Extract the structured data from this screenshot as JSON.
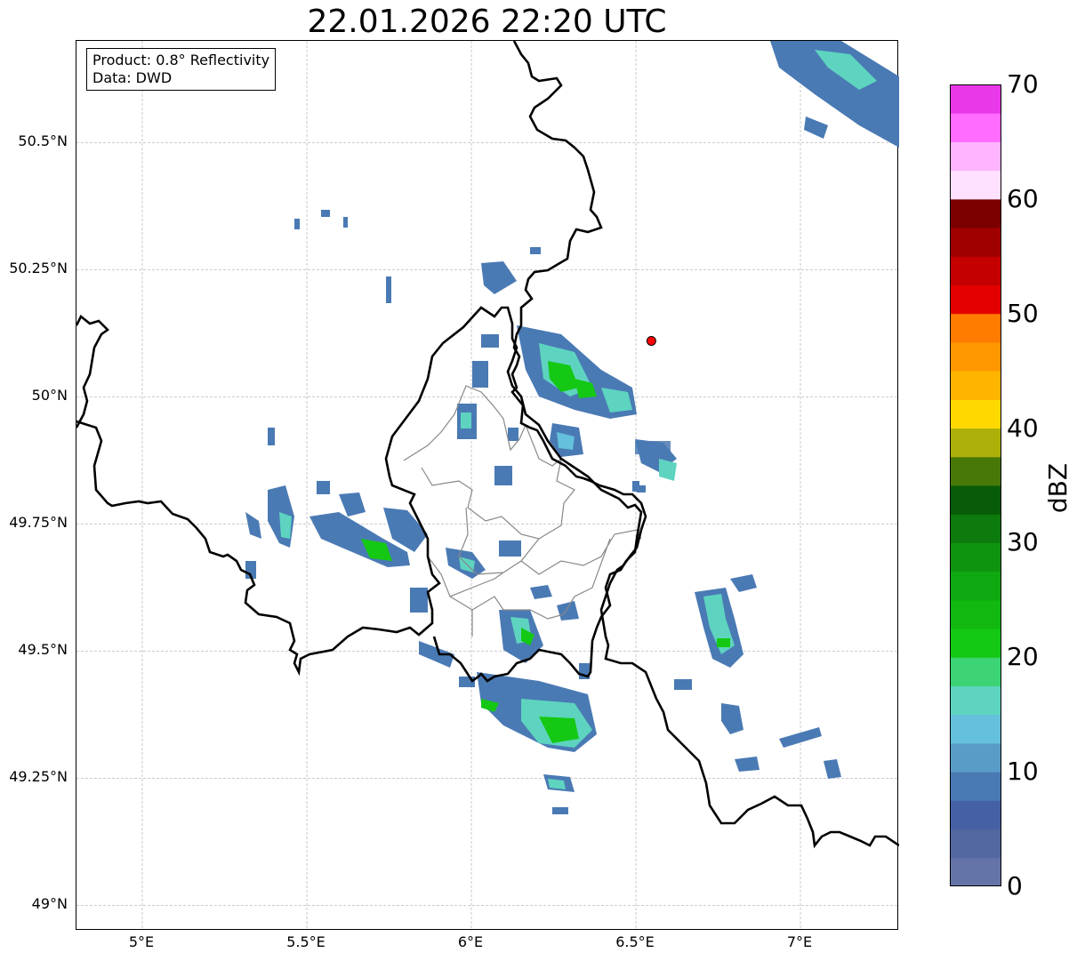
{
  "title": "22.01.2026 22:20 UTC",
  "info_box": {
    "product": "Product: 0.8° Reflectivity",
    "data_source": "Data: DWD"
  },
  "map": {
    "projection": "lat-lon",
    "lon_range": [
      4.8,
      7.3
    ],
    "lat_range": [
      48.95,
      50.7
    ],
    "grid": true,
    "lat_ticks": [
      {
        "value": 50.5,
        "label": "50.5°N"
      },
      {
        "value": 50.25,
        "label": "50.25°N"
      },
      {
        "value": 50.0,
        "label": "50°N"
      },
      {
        "value": 49.75,
        "label": "49.75°N"
      },
      {
        "value": 49.5,
        "label": "49.5°N"
      },
      {
        "value": 49.25,
        "label": "49.25°N"
      },
      {
        "value": 49.0,
        "label": "49°N"
      }
    ],
    "lon_ticks": [
      {
        "value": 5.0,
        "label": "5°E"
      },
      {
        "value": 5.5,
        "label": "5.5°E"
      },
      {
        "value": 6.0,
        "label": "6°E"
      },
      {
        "value": 6.5,
        "label": "6.5°E"
      },
      {
        "value": 7.0,
        "label": "7°E"
      }
    ],
    "radar_site": {
      "lon": 6.547,
      "lat": 50.11,
      "color": "#ff0000"
    },
    "border_color": "#000000",
    "admin_border_color": "#888888"
  },
  "colorbar": {
    "label": "dBZ",
    "min": 0,
    "max": 70,
    "tick_labels": [
      "0",
      "10",
      "20",
      "30",
      "40",
      "50",
      "60",
      "70"
    ],
    "colors": [
      "#6474a8",
      "#5468a0",
      "#4660a4",
      "#4a7ab4",
      "#5a9cc8",
      "#64c0dc",
      "#5ed4c0",
      "#3cd474",
      "#14c814",
      "#10b810",
      "#10a810",
      "#0e940e",
      "#0c7a0c",
      "#085c08",
      "#487808",
      "#acb008",
      "#ffd800",
      "#ffb400",
      "#ff9800",
      "#ff7c00",
      "#e40000",
      "#c40000",
      "#a00000",
      "#7c0000",
      "#ffe0ff",
      "#ffb4ff",
      "#ff6cff",
      "#e838e8"
    ]
  }
}
